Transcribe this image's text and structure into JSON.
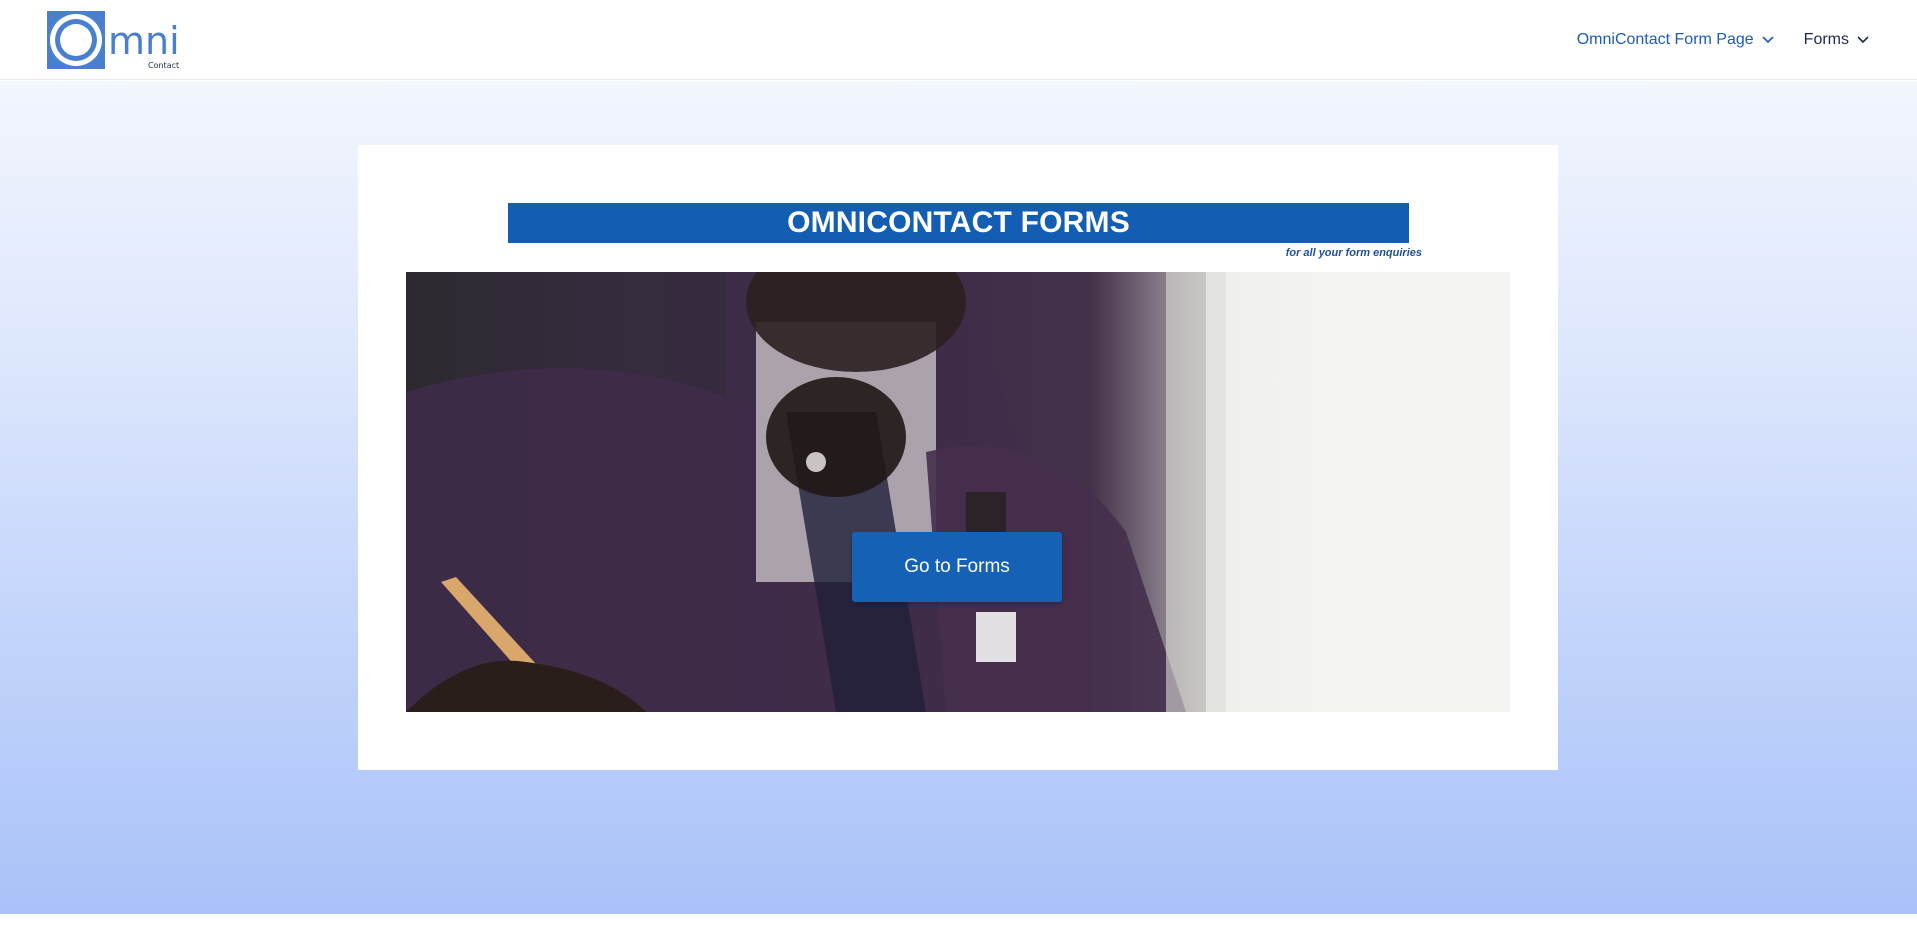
{
  "header": {
    "logo": {
      "text": "mni",
      "subtext": "Contact",
      "icon": "omni-logo-icon",
      "color": "#4a7fd0"
    },
    "nav": [
      {
        "label": "OmniContact Form Page",
        "icon": "chevron-down-icon"
      },
      {
        "label": "Forms",
        "icon": "chevron-down-icon"
      }
    ]
  },
  "hero": {
    "title": "OMNICONTACT FORMS",
    "tagline": "for all your form enquiries",
    "cta_label": "Go to Forms",
    "photo_icon": "businessman-photo",
    "colors": {
      "title_bar": "#135eb3",
      "cta": "#1461b5",
      "gradient_top": "#f3f6fd",
      "gradient_bottom": "#a9c2f8"
    }
  }
}
